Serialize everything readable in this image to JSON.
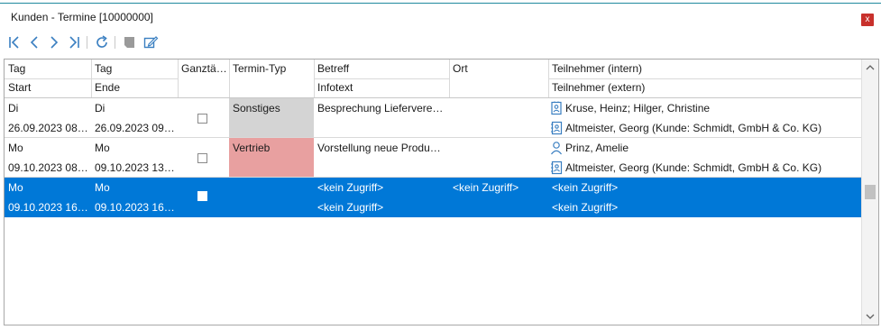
{
  "window": {
    "title": "Kunden - Termine [10000000]",
    "close_label": "x"
  },
  "toolbar": {
    "icons": [
      "first-icon",
      "previous-icon",
      "next-icon",
      "last-icon",
      "refresh-icon",
      "delete-icon",
      "edit-icon"
    ]
  },
  "columns": {
    "row1": [
      "Tag",
      "Tag",
      "Ganztä…",
      "Termin-Typ",
      "Betreff",
      "Ort",
      "Teilnehmer (intern)"
    ],
    "row2": [
      "Start",
      "Ende",
      "",
      "",
      "Infotext",
      "",
      "Teilnehmer (extern)"
    ]
  },
  "rows": [
    {
      "day_start": "Di",
      "day_end": "Di",
      "start": "26.09.2023 08…",
      "end": "26.09.2023 09…",
      "allday": false,
      "type": "Sonstiges",
      "type_color": "#d4d4d4",
      "subject": "Besprechung Liefervere…",
      "info": "",
      "location": "",
      "internal": "Kruse, Heinz; Hilger, Christine",
      "internal_icon": "contact-card-icon",
      "external": "Altmeister, Georg (Kunde: Schmidt, GmbH & Co. KG)",
      "external_icon": "address-book-icon",
      "selected": false
    },
    {
      "day_start": "Mo",
      "day_end": "Mo",
      "start": "09.10.2023 08…",
      "end": "09.10.2023 13…",
      "allday": false,
      "type": "Vertrieb",
      "type_color": "#e8a0a0",
      "subject": "Vorstellung neue Produ…",
      "info": "",
      "location": "",
      "internal": "Prinz, Amelie",
      "internal_icon": "person-icon",
      "external": "Altmeister, Georg (Kunde: Schmidt, GmbH & Co. KG)",
      "external_icon": "address-book-icon",
      "selected": false
    },
    {
      "day_start": "Mo",
      "day_end": "Mo",
      "start": "09.10.2023 16…",
      "end": "09.10.2023 16…",
      "allday": false,
      "type": "",
      "type_color": "",
      "subject": "<kein Zugriff>",
      "info": "<kein Zugriff>",
      "location": "<kein Zugriff>",
      "internal": "<kein Zugriff>",
      "internal_icon": "",
      "external": "<kein Zugriff>",
      "external_icon": "",
      "selected": true
    }
  ],
  "colors": {
    "selection": "#0078d7",
    "accent_line": "#1f8a9e",
    "close": "#c8312c",
    "toolbar_icon": "#3a7fc1"
  }
}
